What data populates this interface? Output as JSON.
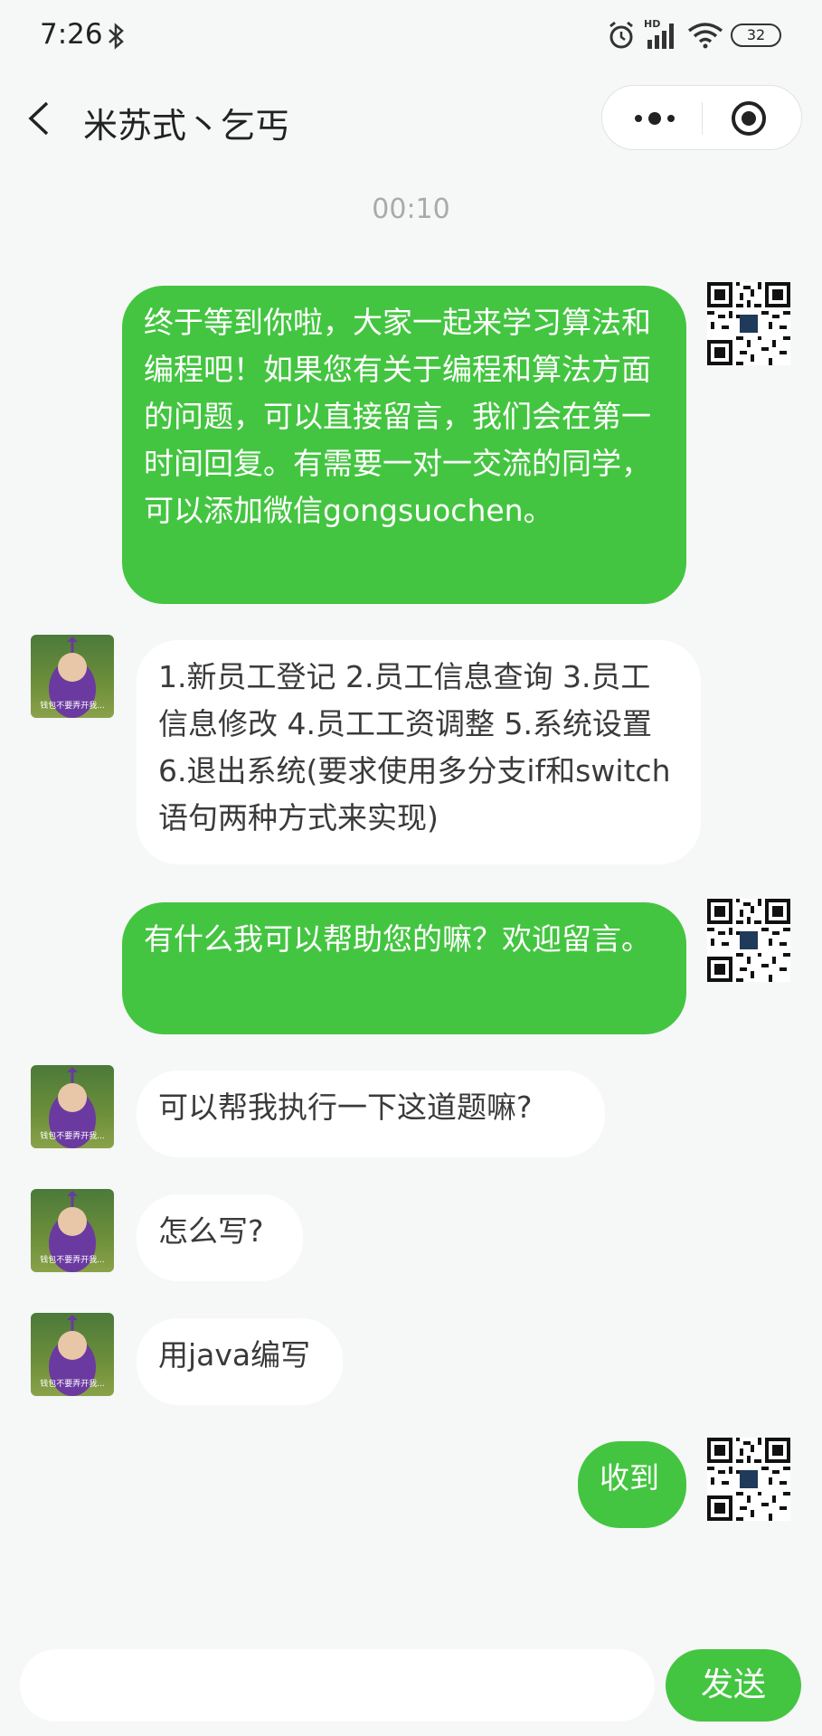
{
  "status_bar": {
    "time": "7:26",
    "battery": "32",
    "network": "HD"
  },
  "nav": {
    "title": "米苏式丶乞丐"
  },
  "chat": {
    "timestamp": "00:10",
    "messages": [
      {
        "side": "right",
        "text": "终于等到你啦，大家一起来学习算法和编程吧！如果您有关于编程和算法方面的问题，可以直接留言，我们会在第一时间回复。有需要一对一交流的同学，可以添加微信gongsuochen。"
      },
      {
        "side": "left",
        "text": "1.新员工登记 2.员工信息查询 3.员工信息修改 4.员工工资调整 5.系统设置 6.退出系统(要求使用多分支if和switch语句两种方式来实现)"
      },
      {
        "side": "right",
        "text": "有什么我可以帮助您的嘛？欢迎留言。"
      },
      {
        "side": "left",
        "text": "可以帮我执行一下这道题嘛?"
      },
      {
        "side": "left",
        "text": "怎么写?"
      },
      {
        "side": "left",
        "text": "用java编写"
      },
      {
        "side": "right",
        "text": "收到"
      }
    ],
    "avatar_caption": "钱包不要弄开我..."
  },
  "input": {
    "value": "",
    "placeholder": "",
    "send_label": "发送"
  },
  "colors": {
    "bubble_green": "#44c541",
    "background": "#f6f7f7"
  }
}
